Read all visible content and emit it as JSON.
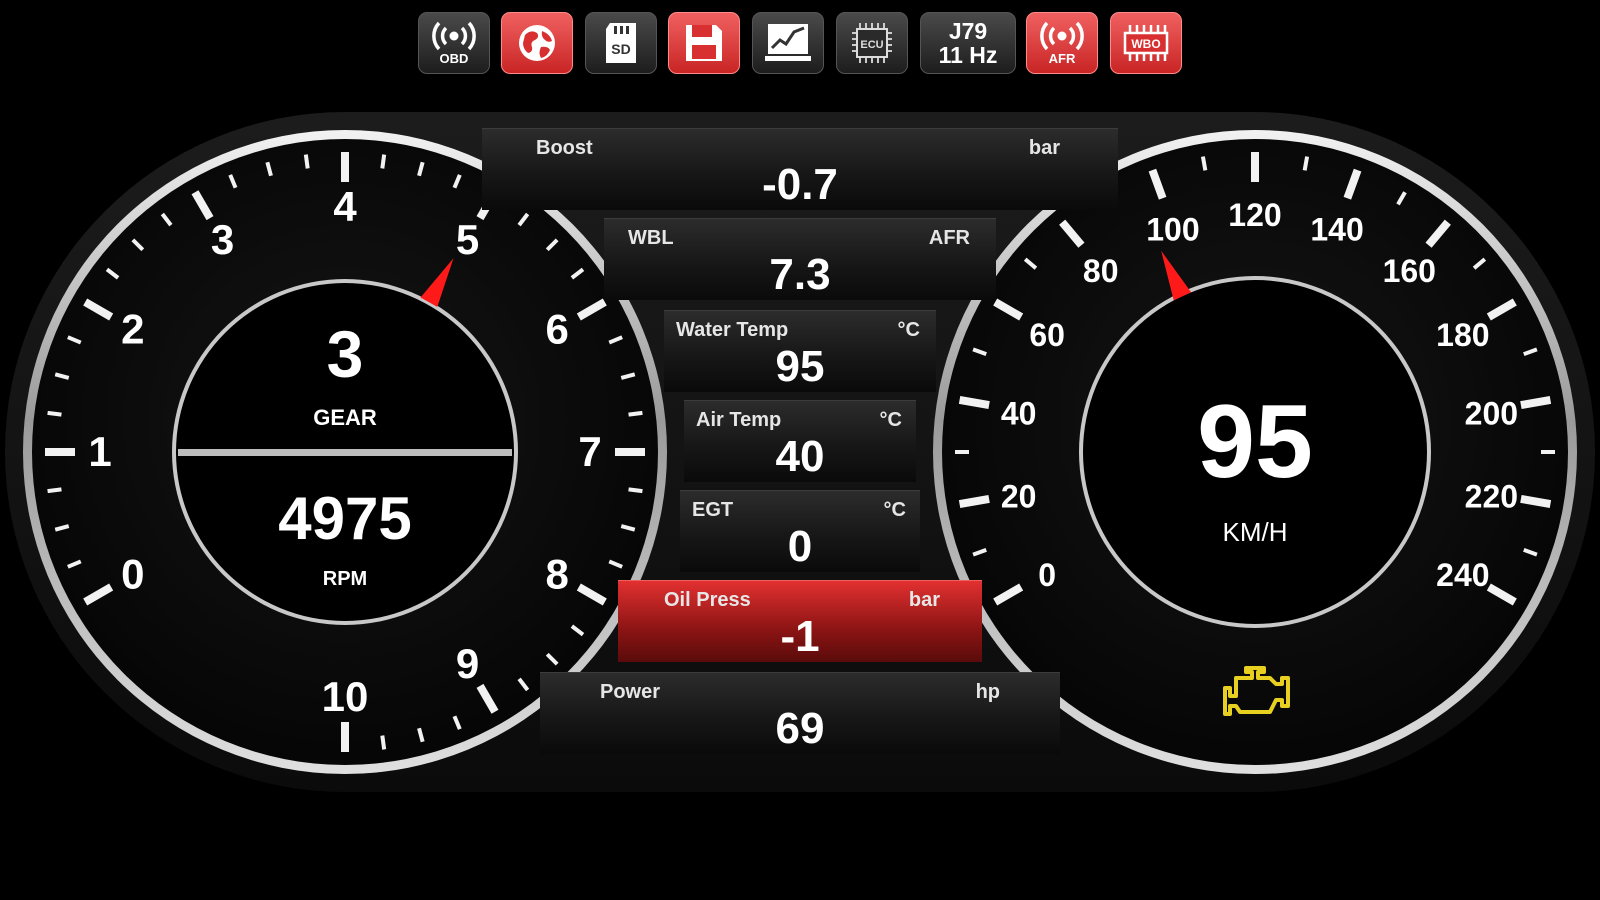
{
  "toolbar": {
    "buttons": [
      {
        "name": "obd",
        "caption": "OBD",
        "style": "gray"
      },
      {
        "name": "globe",
        "caption": "",
        "style": "red"
      },
      {
        "name": "sd",
        "caption": "SD",
        "style": "gray"
      },
      {
        "name": "save",
        "caption": "",
        "style": "red"
      },
      {
        "name": "chart",
        "caption": "",
        "style": "gray"
      },
      {
        "name": "ecu",
        "caption": "ECU",
        "style": "gray"
      },
      {
        "name": "protocol",
        "line1": "J79",
        "line2": "11 Hz",
        "style": "gray"
      },
      {
        "name": "afr",
        "caption": "AFR",
        "style": "red"
      },
      {
        "name": "wbo",
        "caption": "WBO",
        "style": "red"
      }
    ]
  },
  "tach": {
    "gear_value": "3",
    "gear_label": "GEAR",
    "rpm_value": "4975",
    "rpm_label": "RPM",
    "scale_labels": [
      "0",
      "1",
      "2",
      "3",
      "4",
      "5",
      "6",
      "7",
      "8",
      "9",
      "10"
    ],
    "needle_value": 4.975
  },
  "speedo": {
    "speed_value": "95",
    "speed_unit": "KM/H",
    "scale_labels": [
      "0",
      "20",
      "40",
      "60",
      "80",
      "100",
      "120",
      "140",
      "160",
      "180",
      "200",
      "220",
      "240"
    ],
    "needle_value": 95
  },
  "readouts": [
    {
      "label": "Boost",
      "unit": "bar",
      "value": "-0.7",
      "alert": false
    },
    {
      "label": "WBL",
      "unit": "AFR",
      "value": "7.3",
      "alert": false
    },
    {
      "label": "Water Temp",
      "unit": "°C",
      "value": "95",
      "alert": false
    },
    {
      "label": "Air Temp",
      "unit": "°C",
      "value": "40",
      "alert": false
    },
    {
      "label": "EGT",
      "unit": "°C",
      "value": "0",
      "alert": false
    },
    {
      "label": "Oil Press",
      "unit": "bar",
      "value": "-1",
      "alert": true
    },
    {
      "label": "Power",
      "unit": "hp",
      "value": "69",
      "alert": false
    }
  ],
  "warning_icon": "check-engine-icon",
  "colors": {
    "accent_red": "#e23030",
    "needle_red": "#ff1a1a",
    "warning_yellow": "#e8d020"
  }
}
